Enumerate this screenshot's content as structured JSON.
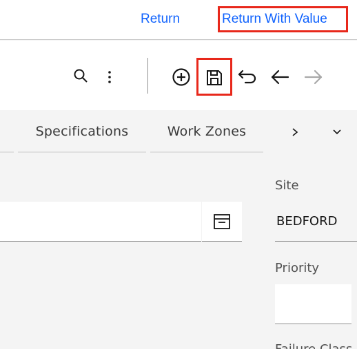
{
  "top_links": {
    "return_label": "Return",
    "return_with_value_label": "Return With Value"
  },
  "toolbar": {
    "icons": [
      "search-icon",
      "more-options-icon",
      "add-icon",
      "save-icon",
      "undo-icon",
      "back-arrow-icon",
      "forward-arrow-icon"
    ]
  },
  "tabs": [
    {
      "label": "Specifications"
    },
    {
      "label": "Work Zones"
    }
  ],
  "fields": {
    "site_label": "Site",
    "site_value": "BEDFORD",
    "priority_label": "Priority",
    "priority_value": "",
    "failure_class_label": "Failure Class"
  },
  "colors": {
    "link": "#0f62fe",
    "highlight": "#e8281b",
    "background": "#f4f4f4"
  }
}
